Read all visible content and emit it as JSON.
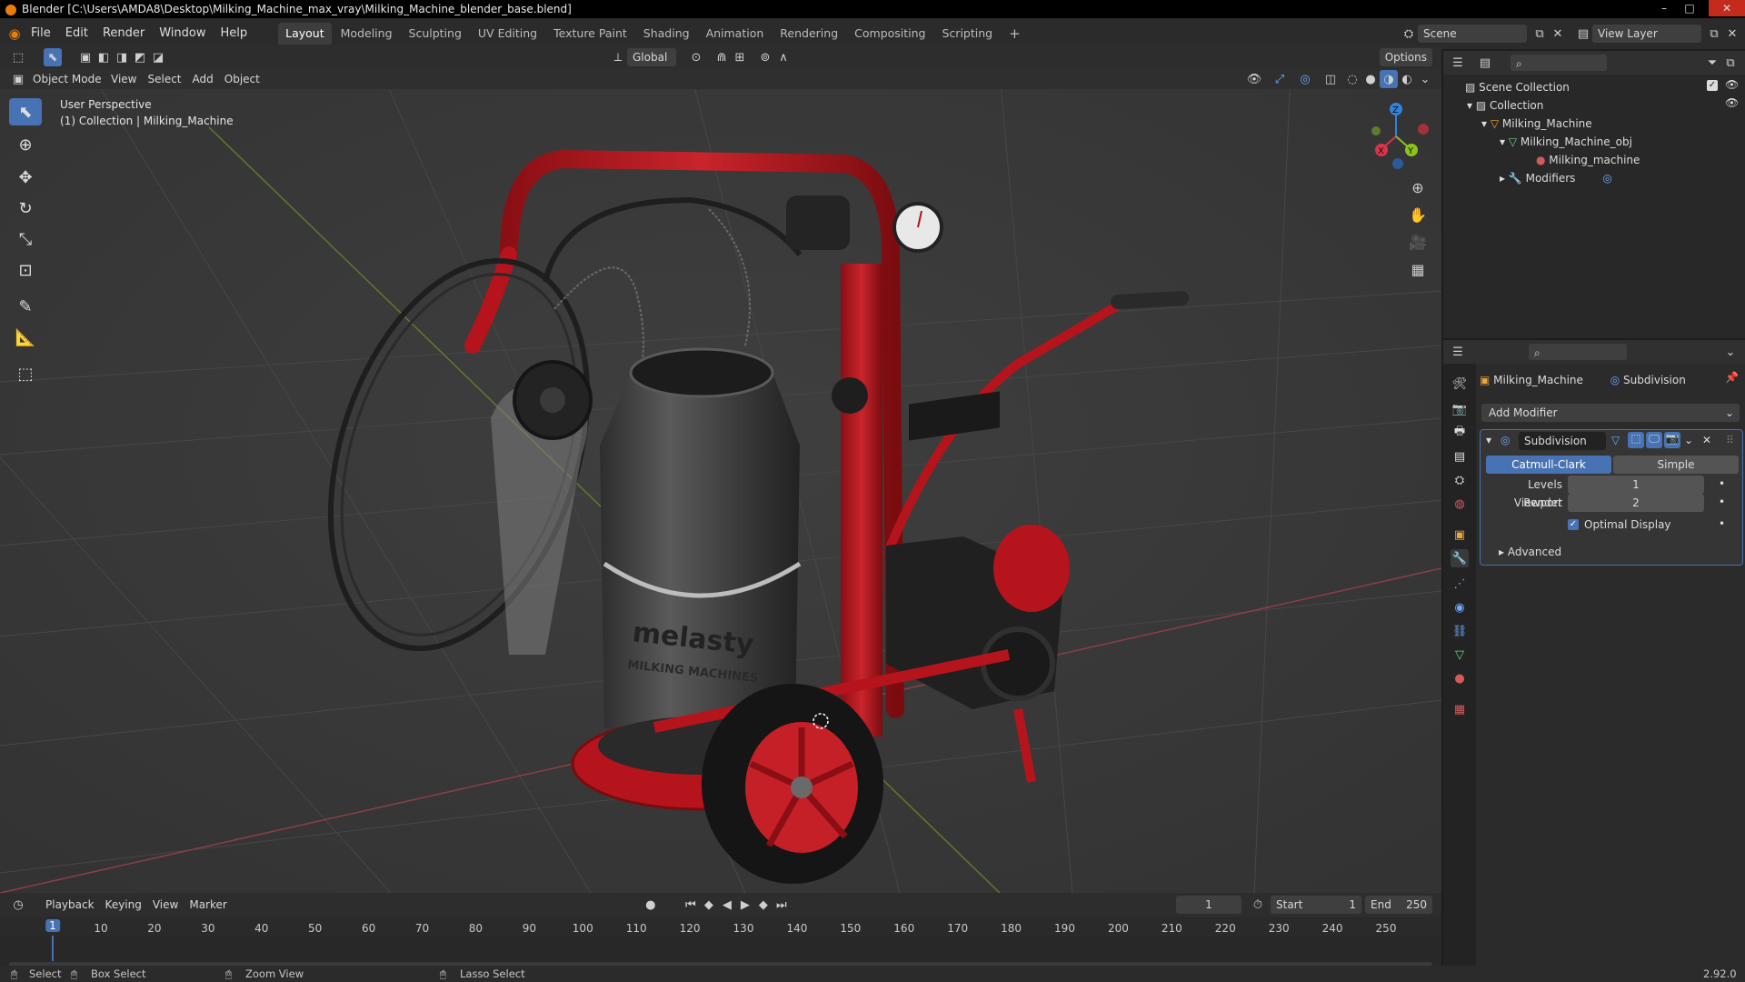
{
  "window": {
    "title": "Blender [C:\\Users\\AMDA8\\Desktop\\Milking_Machine_max_vray\\Milking_Machine_blender_base.blend]",
    "min": "–",
    "max": "□",
    "close": "✕"
  },
  "menu": [
    "File",
    "Edit",
    "Render",
    "Window",
    "Help"
  ],
  "workspaces": [
    "Layout",
    "Modeling",
    "Sculpting",
    "UV Editing",
    "Texture Paint",
    "Shading",
    "Animation",
    "Rendering",
    "Compositing",
    "Scripting"
  ],
  "add_workspace": "+",
  "scene": {
    "name": "Scene",
    "view_layer": "View Layer"
  },
  "tool_header": {
    "orientation": "Global",
    "options": "Options"
  },
  "viewport_header": {
    "mode": "Object Mode",
    "menus": [
      "View",
      "Select",
      "Add",
      "Object"
    ]
  },
  "viewport": {
    "perspective": "User Perspective",
    "collection_info": "(1) Collection | Milking_Machine",
    "gizmo": {
      "x": "X",
      "y": "Y",
      "z": "Z"
    },
    "colors": {
      "x_axis": "#d9354a",
      "y_axis": "#8bc21c",
      "z_axis": "#2f83e0",
      "product_red": "#b5141c",
      "grid": "#444444"
    },
    "product_text": {
      "brand": "melasty",
      "sub": "MILKING MACHINES"
    }
  },
  "tools": [
    "select-box",
    "cursor",
    "move",
    "rotate",
    "scale",
    "transform",
    "annotate",
    "measure",
    "add-cube"
  ],
  "outliner": {
    "root": "Scene Collection",
    "items": [
      {
        "label": "Collection"
      },
      {
        "label": "Milking_Machine"
      },
      {
        "label": "Milking_Machine_obj"
      },
      {
        "label": "Milking_machine"
      },
      {
        "label": "Modifiers"
      }
    ]
  },
  "properties": {
    "object": "Milking_Machine",
    "modifier_context": "Subdivision",
    "add_modifier": "Add Modifier",
    "modifier": {
      "name": "Subdivision",
      "mode_active": "Catmull-Clark",
      "mode_other": "Simple",
      "levels_viewport_label": "Levels Viewport",
      "levels_viewport": "1",
      "render_label": "Render",
      "render": "2",
      "optimal_display": "Optimal Display",
      "advanced": "Advanced"
    }
  },
  "timeline": {
    "menus": [
      "Playback",
      "Keying",
      "View",
      "Marker"
    ],
    "current_frame": "1",
    "start_label": "Start",
    "start": "1",
    "end_label": "End",
    "end": "250",
    "ticks": [
      "1",
      "10",
      "20",
      "30",
      "40",
      "50",
      "60",
      "70",
      "80",
      "90",
      "100",
      "110",
      "120",
      "130",
      "140",
      "150",
      "160",
      "170",
      "180",
      "190",
      "200",
      "210",
      "220",
      "230",
      "240",
      "250"
    ]
  },
  "statusbar": {
    "select": "Select",
    "box_select": "Box Select",
    "zoom_view": "Zoom View",
    "lasso_select": "Lasso Select",
    "version": "2.92.0"
  }
}
